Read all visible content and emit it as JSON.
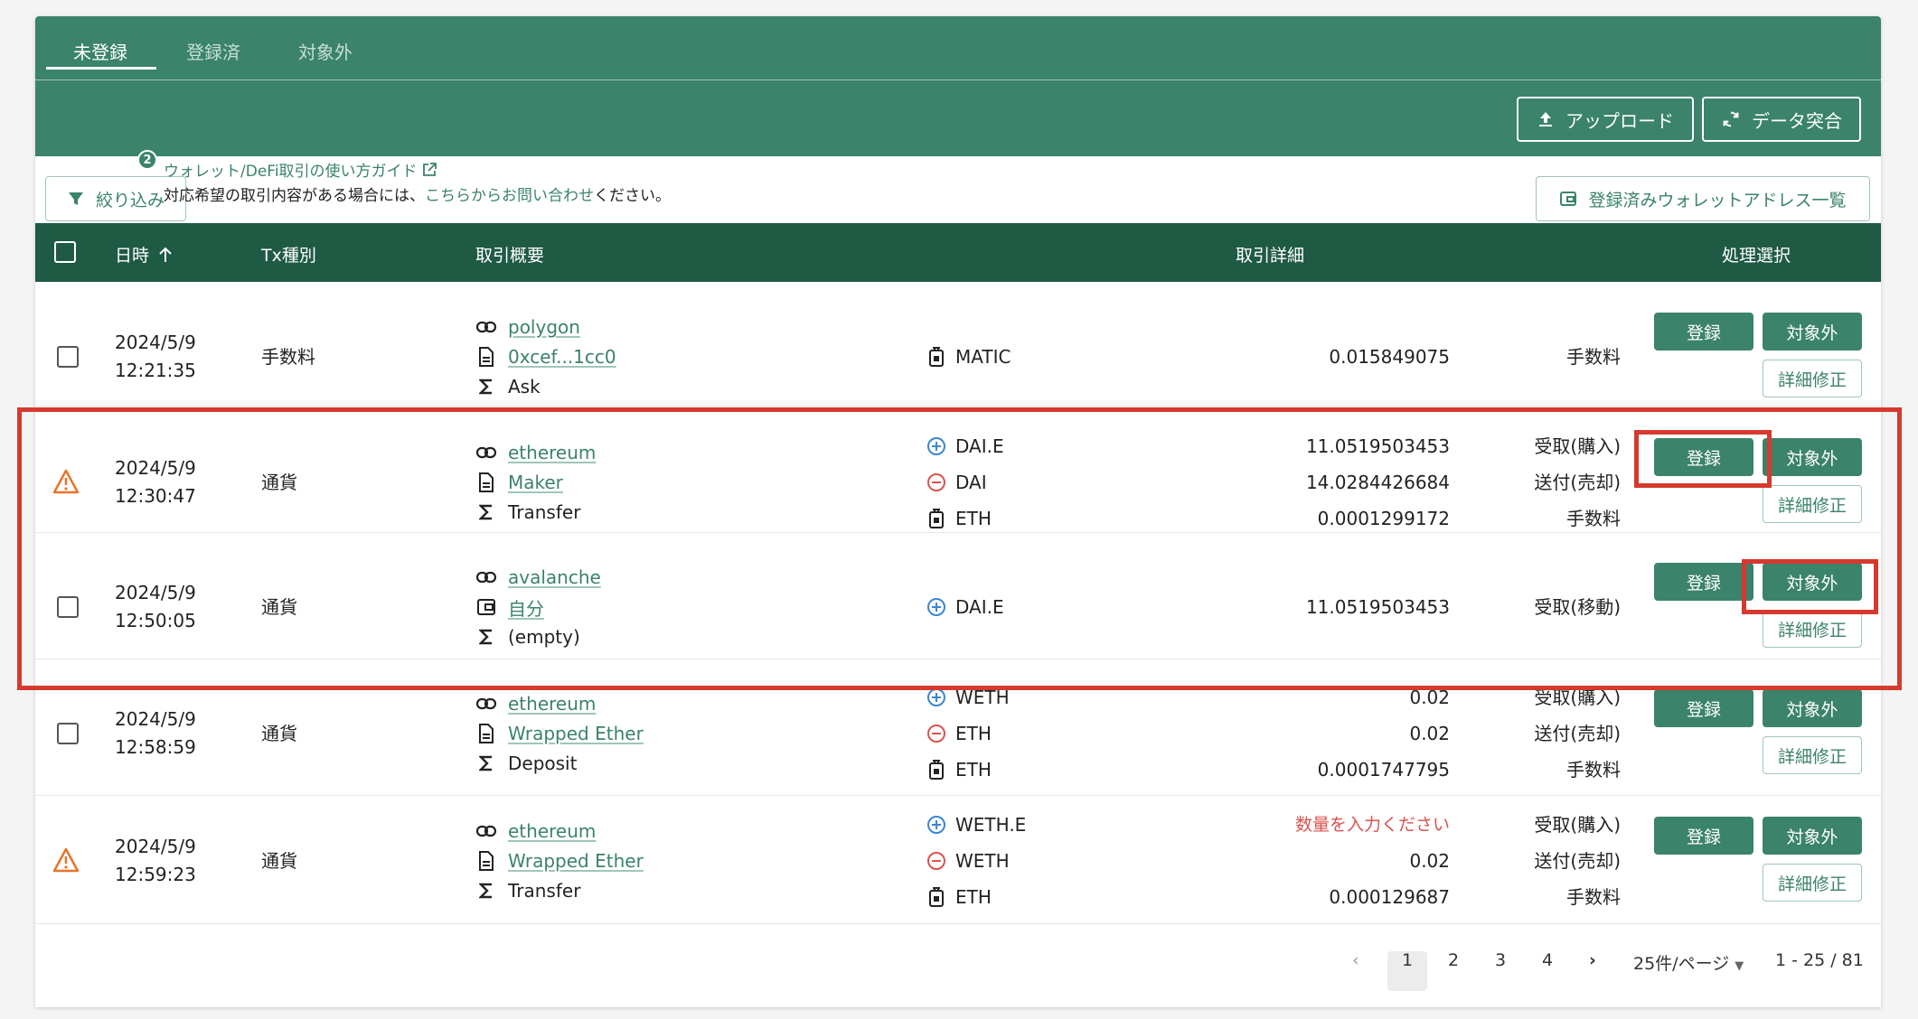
{
  "tabs": [
    "未登録",
    "登録済",
    "対象外"
  ],
  "header_buttons": {
    "upload": "アップロード",
    "reconcile": "データ突合"
  },
  "toolbar": {
    "filter_label": "絞り込み",
    "filter_badge": "2",
    "guide_link": "ウォレット/DeFi取引の使い方ガイド",
    "notice_prefix": "対応希望の取引内容がある場合には、",
    "notice_link": "こちらからお問い合わせ",
    "notice_suffix": "ください。",
    "wallet_list": "登録済みウォレットアドレス一覧"
  },
  "columns": {
    "datetime": "日時",
    "tx_type": "Tx種別",
    "summary": "取引概要",
    "detail": "取引詳細",
    "action": "処理選択"
  },
  "row_buttons": {
    "register": "登録",
    "exclude": "対象外",
    "edit": "詳細修正"
  },
  "rows": [
    {
      "warn": false,
      "date": "2024/5/9",
      "time": "12:21:35",
      "type": "手数料",
      "chain": "polygon",
      "contract": "0xcef...1cc0",
      "contract_icon": "document-icon",
      "method": "Ask",
      "detail": [
        {
          "icon": "fee-icon",
          "token": "MATIC",
          "amount": "0.015849075",
          "kind": "手数料"
        }
      ]
    },
    {
      "warn": true,
      "date": "2024/5/9",
      "time": "12:30:47",
      "type": "通貨",
      "chain": "ethereum",
      "contract": "Maker",
      "contract_icon": "document-icon",
      "method": "Transfer",
      "detail": [
        {
          "icon": "plus-icon",
          "token": "DAI.E",
          "amount": "11.0519503453",
          "kind": "受取(購入)"
        },
        {
          "icon": "minus-icon",
          "token": "DAI",
          "amount": "14.0284426684",
          "kind": "送付(売却)"
        },
        {
          "icon": "fee-icon",
          "token": "ETH",
          "amount": "0.0001299172",
          "kind": "手数料"
        }
      ]
    },
    {
      "warn": false,
      "date": "2024/5/9",
      "time": "12:50:05",
      "type": "通貨",
      "chain": "avalanche",
      "contract": "自分",
      "contract_icon": "wallet-icon",
      "method": "(empty)",
      "detail": [
        {
          "icon": "plus-icon",
          "token": "DAI.E",
          "amount": "11.0519503453",
          "kind": "受取(移動)"
        }
      ]
    },
    {
      "warn": false,
      "date": "2024/5/9",
      "time": "12:58:59",
      "type": "通貨",
      "chain": "ethereum",
      "contract": "Wrapped Ether",
      "contract_icon": "document-icon",
      "method": "Deposit",
      "detail": [
        {
          "icon": "plus-icon",
          "token": "WETH",
          "amount": "0.02",
          "kind": "受取(購入)"
        },
        {
          "icon": "minus-icon",
          "token": "ETH",
          "amount": "0.02",
          "kind": "送付(売却)"
        },
        {
          "icon": "fee-icon",
          "token": "ETH",
          "amount": "0.0001747795",
          "kind": "手数料"
        }
      ]
    },
    {
      "warn": true,
      "date": "2024/5/9",
      "time": "12:59:23",
      "type": "通貨",
      "chain": "ethereum",
      "contract": "Wrapped Ether",
      "contract_icon": "document-icon",
      "method": "Transfer",
      "detail": [
        {
          "icon": "plus-icon",
          "token": "WETH.E",
          "amount": "数量を入力ください",
          "amount_error": true,
          "kind": "受取(購入)"
        },
        {
          "icon": "minus-icon",
          "token": "WETH",
          "amount": "0.02",
          "kind": "送付(売却)"
        },
        {
          "icon": "fee-icon",
          "token": "ETH",
          "amount": "0.000129687",
          "kind": "手数料"
        }
      ]
    }
  ],
  "pagination": {
    "pages": [
      "1",
      "2",
      "3",
      "4"
    ],
    "current": "1",
    "per_page": "25件/ページ",
    "range": "1 - 25 / 81"
  },
  "colors": {
    "brand": "#3b836a",
    "header_dark": "#1f5a44",
    "warning": "#e8742b",
    "plus": "#3a86d1",
    "minus": "#d9534f",
    "highlight": "#d63a2e"
  }
}
